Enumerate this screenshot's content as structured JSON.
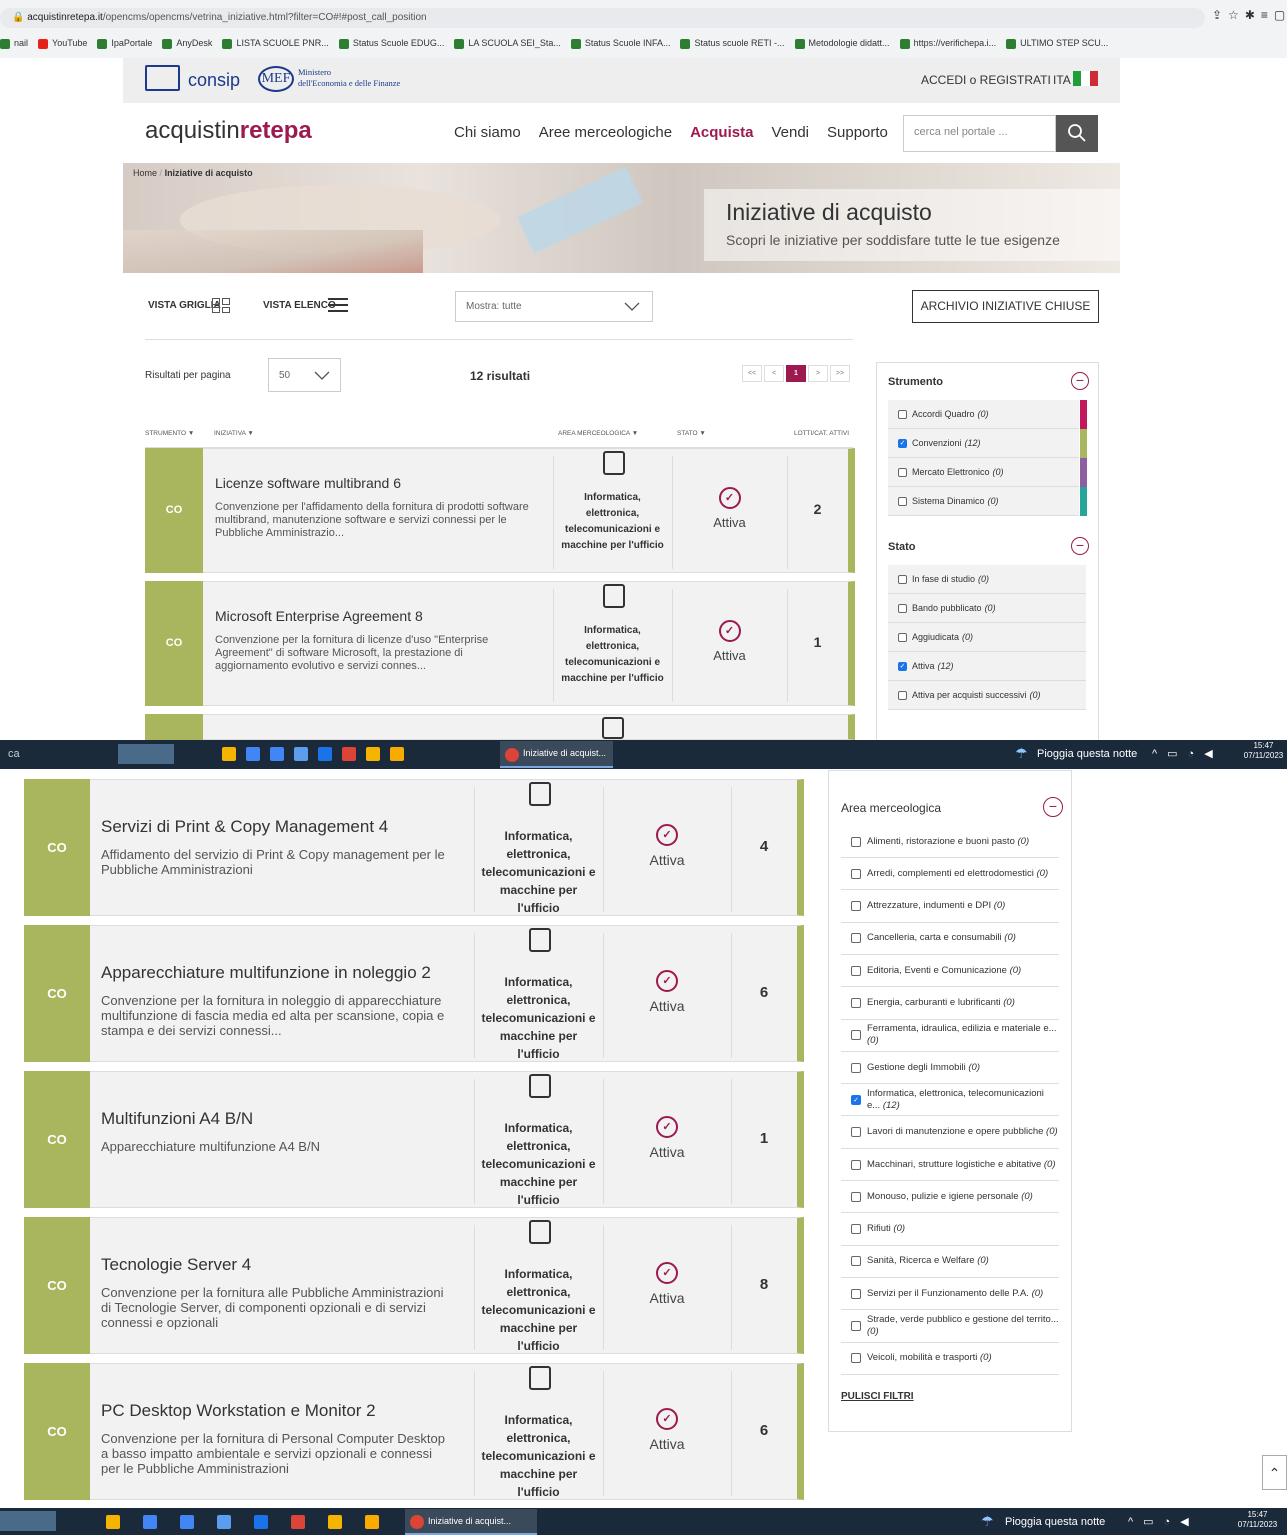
{
  "browser": {
    "url_domain": "acquistinretepa.it",
    "url_path": "/opencms/opencms/vetrina_iniziative.html?filter=CO#!#post_call_position",
    "bookmarks": [
      "nail",
      "YouTube",
      "IpaPortale",
      "AnyDesk",
      "LISTA SCUOLE PNR...",
      "Status Scuole EDUG...",
      "LA SCUOLA SEI_Sta...",
      "Status Scuole INFA...",
      "Status scuole RETI -...",
      "Metodologie didatt...",
      "https://verifichepa.i...",
      "ULTIMO STEP SCU..."
    ]
  },
  "topbar": {
    "consip": "consip",
    "mef": "MEF",
    "mef_line1": "Ministero",
    "mef_line2": "dell'Economia e delle Finanze",
    "login": "ACCEDI o REGISTRATI",
    "lang": "ITA",
    "flag_colors": [
      "#1f9e3a",
      "#ffffff",
      "#ce2b37"
    ]
  },
  "header": {
    "brand_pre": "acquistin",
    "brand_mid": "rete",
    "brand_post": "pa",
    "nav": [
      "Chi siamo",
      "Aree merceologiche",
      "Acquista",
      "Vendi",
      "Supporto"
    ],
    "search_placeholder": "cerca nel portale ..."
  },
  "hero": {
    "breadcrumb_home": "Home",
    "breadcrumb_sep": "/",
    "breadcrumb_current": "Iniziative di acquisto",
    "title": "Iniziative di acquisto",
    "subtitle": "Scopri le iniziative per soddisfare tutte le tue esigenze"
  },
  "toolbar": {
    "vista_griglia": "VISTA GRIGLIA",
    "vista_elenco": "VISTA ELENCO",
    "mostra": "Mostra: tutte",
    "archivio": "ARCHIVIO INIZIATIVE CHIUSE",
    "rpp_label": "Risultati per pagina",
    "rpp_value": "50",
    "results": "12 risultati",
    "pager": [
      "<<",
      "<",
      "1",
      ">",
      ">>"
    ]
  },
  "columns": {
    "strumento": "STRUMENTO",
    "iniziativa": "INIZIATIVA",
    "area": "AREA MERCEOLOGICA",
    "stato": "STATO",
    "lotti": "LOTTI/CAT. ATTIVI"
  },
  "cards_top": [
    {
      "code": "CO",
      "title": "Licenze software multibrand 6",
      "desc": "Convenzione per l'affidamento della fornitura di prodotti software multibrand, manutenzione software e servizi connessi per le Pubbliche Amministrazio...",
      "area": "Informatica, elettronica, telecomunicazioni e macchine per l'ufficio",
      "stato": "Attiva",
      "lotti": "2"
    },
    {
      "code": "CO",
      "title": "Microsoft Enterprise Agreement 8",
      "desc": "Convenzione per la fornitura di licenze d'uso \"Enterprise Agreement\" di software Microsoft, la prestazione di aggiornamento evolutivo e servizi connes...",
      "area": "Informatica, elettronica, telecomunicazioni e macchine per l'ufficio",
      "stato": "Attiva",
      "lotti": "1"
    }
  ],
  "cards_bottom": [
    {
      "code": "CO",
      "title": "Servizi di Print & Copy Management 4",
      "desc": "Affidamento del servizio di Print & Copy management per le Pubbliche Amministrazioni",
      "area": "Informatica, elettronica, telecomunicazioni e macchine per l'ufficio",
      "stato": "Attiva",
      "lotti": "4"
    },
    {
      "code": "CO",
      "title": "Apparecchiature multifunzione in noleggio 2",
      "desc": "Convenzione per la fornitura in noleggio di apparecchiature multifunzione di fascia media ed alta per scansione, copia e stampa e dei servizi connessi...",
      "area": "Informatica, elettronica, telecomunicazioni e macchine per l'ufficio",
      "stato": "Attiva",
      "lotti": "6"
    },
    {
      "code": "CO",
      "title": "Multifunzioni A4 B/N",
      "desc": "Apparecchiature multifunzione A4 B/N",
      "area": "Informatica, elettronica, telecomunicazioni e macchine per l'ufficio",
      "stato": "Attiva",
      "lotti": "1"
    },
    {
      "code": "CO",
      "title": "Tecnologie Server 4",
      "desc": "Convenzione per la fornitura alle Pubbliche Amministrazioni di Tecnologie Server, di componenti opzionali e di servizi connessi e opzionali",
      "area": "Informatica, elettronica, telecomunicazioni e macchine per l'ufficio",
      "stato": "Attiva",
      "lotti": "8"
    },
    {
      "code": "CO",
      "title": "PC Desktop Workstation e Monitor 2",
      "desc": "Convenzione per la fornitura di Personal Computer Desktop a basso impatto ambientale e servizi opzionali e connessi per le Pubbliche Amministrazioni",
      "area": "Informatica, elettronica, telecomunicazioni e macchine per l'ufficio",
      "stato": "Attiva",
      "lotti": "6"
    }
  ],
  "filters": {
    "strumento_title": "Strumento",
    "strumento": [
      {
        "label": "Accordi Quadro",
        "count": "(0)",
        "checked": false,
        "color": "#c2185b"
      },
      {
        "label": "Convenzioni",
        "count": "(12)",
        "checked": true,
        "color": "#a9b65d"
      },
      {
        "label": "Mercato Elettronico",
        "count": "(0)",
        "checked": false,
        "color": "#8e5ea2"
      },
      {
        "label": "Sistema Dinamico",
        "count": "(0)",
        "checked": false,
        "color": "#26a69a"
      }
    ],
    "stato_title": "Stato",
    "stato": [
      {
        "label": "In fase di studio",
        "count": "(0)",
        "checked": false
      },
      {
        "label": "Bando pubblicato",
        "count": "(0)",
        "checked": false
      },
      {
        "label": "Aggiudicata",
        "count": "(0)",
        "checked": false
      },
      {
        "label": "Attiva",
        "count": "(12)",
        "checked": true
      },
      {
        "label": "Attiva per acquisti successivi",
        "count": "(0)",
        "checked": false
      }
    ],
    "area_title": "Area merceologica",
    "area": [
      {
        "label": "Alimenti, ristorazione e buoni pasto",
        "count": "(0)",
        "checked": false
      },
      {
        "label": "Arredi, complementi ed elettrodomestici",
        "count": "(0)",
        "checked": false
      },
      {
        "label": "Attrezzature, indumenti e DPI",
        "count": "(0)",
        "checked": false
      },
      {
        "label": "Cancelleria, carta e consumabili",
        "count": "(0)",
        "checked": false
      },
      {
        "label": "Editoria, Eventi e Comunicazione",
        "count": "(0)",
        "checked": false
      },
      {
        "label": "Energia, carburanti e lubrificanti",
        "count": "(0)",
        "checked": false
      },
      {
        "label": "Ferramenta, idraulica, edilizia e materiale e...",
        "count": "(0)",
        "checked": false
      },
      {
        "label": "Gestione degli Immobili",
        "count": "(0)",
        "checked": false
      },
      {
        "label": "Informatica, elettronica, telecomunicazioni e...",
        "count": "(12)",
        "checked": true
      },
      {
        "label": "Lavori di manutenzione e opere pubbliche",
        "count": "(0)",
        "checked": false
      },
      {
        "label": "Macchinari, strutture logistiche e abitative",
        "count": "(0)",
        "checked": false
      },
      {
        "label": "Monouso, pulizie e igiene personale",
        "count": "(0)",
        "checked": false
      },
      {
        "label": "Rifiuti",
        "count": "(0)",
        "checked": false
      },
      {
        "label": "Sanità, Ricerca e Welfare",
        "count": "(0)",
        "checked": false
      },
      {
        "label": "Servizi per il Funzionamento delle P.A.",
        "count": "(0)",
        "checked": false
      },
      {
        "label": "Strade, verde pubblico e gestione del territo...",
        "count": "(0)",
        "checked": false
      },
      {
        "label": "Veicoli, mobilità e trasporti",
        "count": "(0)",
        "checked": false
      }
    ],
    "pulisci": "PULISCI FILTRI"
  },
  "taskbar": {
    "left_text": "ca",
    "app_label": "Iniziative di acquist...",
    "weather": "Pioggia questa notte",
    "time": "15:47",
    "date": "07/11/2023"
  }
}
